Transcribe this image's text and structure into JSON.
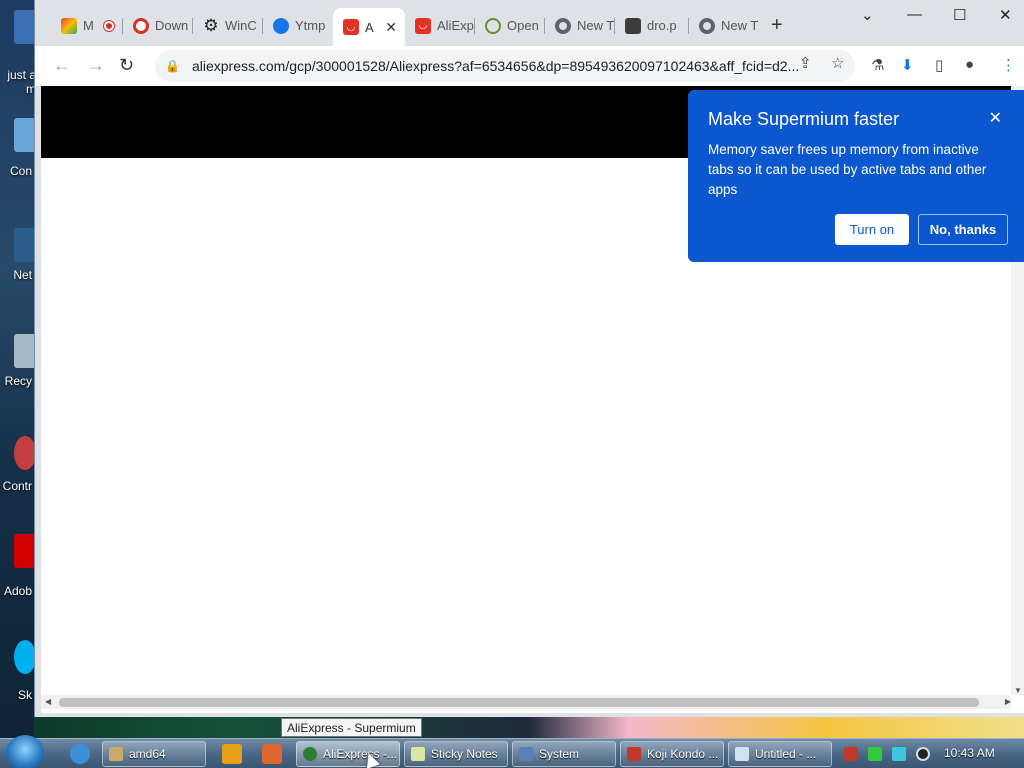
{
  "desktop": {
    "icons": [
      {
        "label": "just a",
        "sublabel": "m"
      },
      {
        "label": "Con"
      },
      {
        "label": "Net"
      },
      {
        "label": "Recy"
      },
      {
        "label": "Contr"
      },
      {
        "label": "Adob"
      },
      {
        "label": "Sk"
      }
    ]
  },
  "browser": {
    "tabs": [
      {
        "title": "M",
        "icon": "gmail-icon",
        "color": "#ea4335"
      },
      {
        "title": "Down",
        "icon": "download-icon",
        "color": "#d93025"
      },
      {
        "title": "WinC",
        "icon": "gear-icon",
        "color": "#202124"
      },
      {
        "title": "Ytmp",
        "icon": "ytmp-icon",
        "color": "#1a73e8"
      },
      {
        "title": "A",
        "icon": "aliexpress-icon",
        "color": "#e43225",
        "active": true
      },
      {
        "title": "AliExp",
        "icon": "aliexpress-icon",
        "color": "#e43225"
      },
      {
        "title": "Open",
        "icon": "openai-icon",
        "color": "#6b8e23"
      },
      {
        "title": "New T",
        "icon": "chrome-icon",
        "color": "#5f6368"
      },
      {
        "title": "dro.p",
        "icon": "image-icon",
        "color": "#3c3c3c"
      },
      {
        "title": "New T",
        "icon": "chrome-icon",
        "color": "#5f6368"
      }
    ],
    "new_tab": "+",
    "url": "aliexpress.com/gcp/300001528/Aliexpress?af=6534656&dp=895493620097102463&aff_fcid=d2..."
  },
  "memory_saver": {
    "title": "Make Supermium faster",
    "body": "Memory saver frees up memory from inactive tabs so it can be used by active tabs and other apps",
    "turn_on": "Turn on",
    "no_thanks": "No, thanks",
    "accent": "#0b57d0"
  },
  "tooltip": "AliExpress - Supermium",
  "taskbar": {
    "buttons": [
      {
        "label": "amd64",
        "icon": "folder-icon"
      },
      {
        "label": "AliExpress -...",
        "icon": "browser-icon",
        "active": true
      },
      {
        "label": "Sticky Notes",
        "icon": "sticky-notes-icon"
      },
      {
        "label": "System",
        "icon": "system-icon"
      },
      {
        "label": "Koji Kondo ...",
        "icon": "music-icon"
      },
      {
        "label": "Untitled - ...",
        "icon": "notepad-icon"
      }
    ],
    "clock": "10:43 AM"
  }
}
